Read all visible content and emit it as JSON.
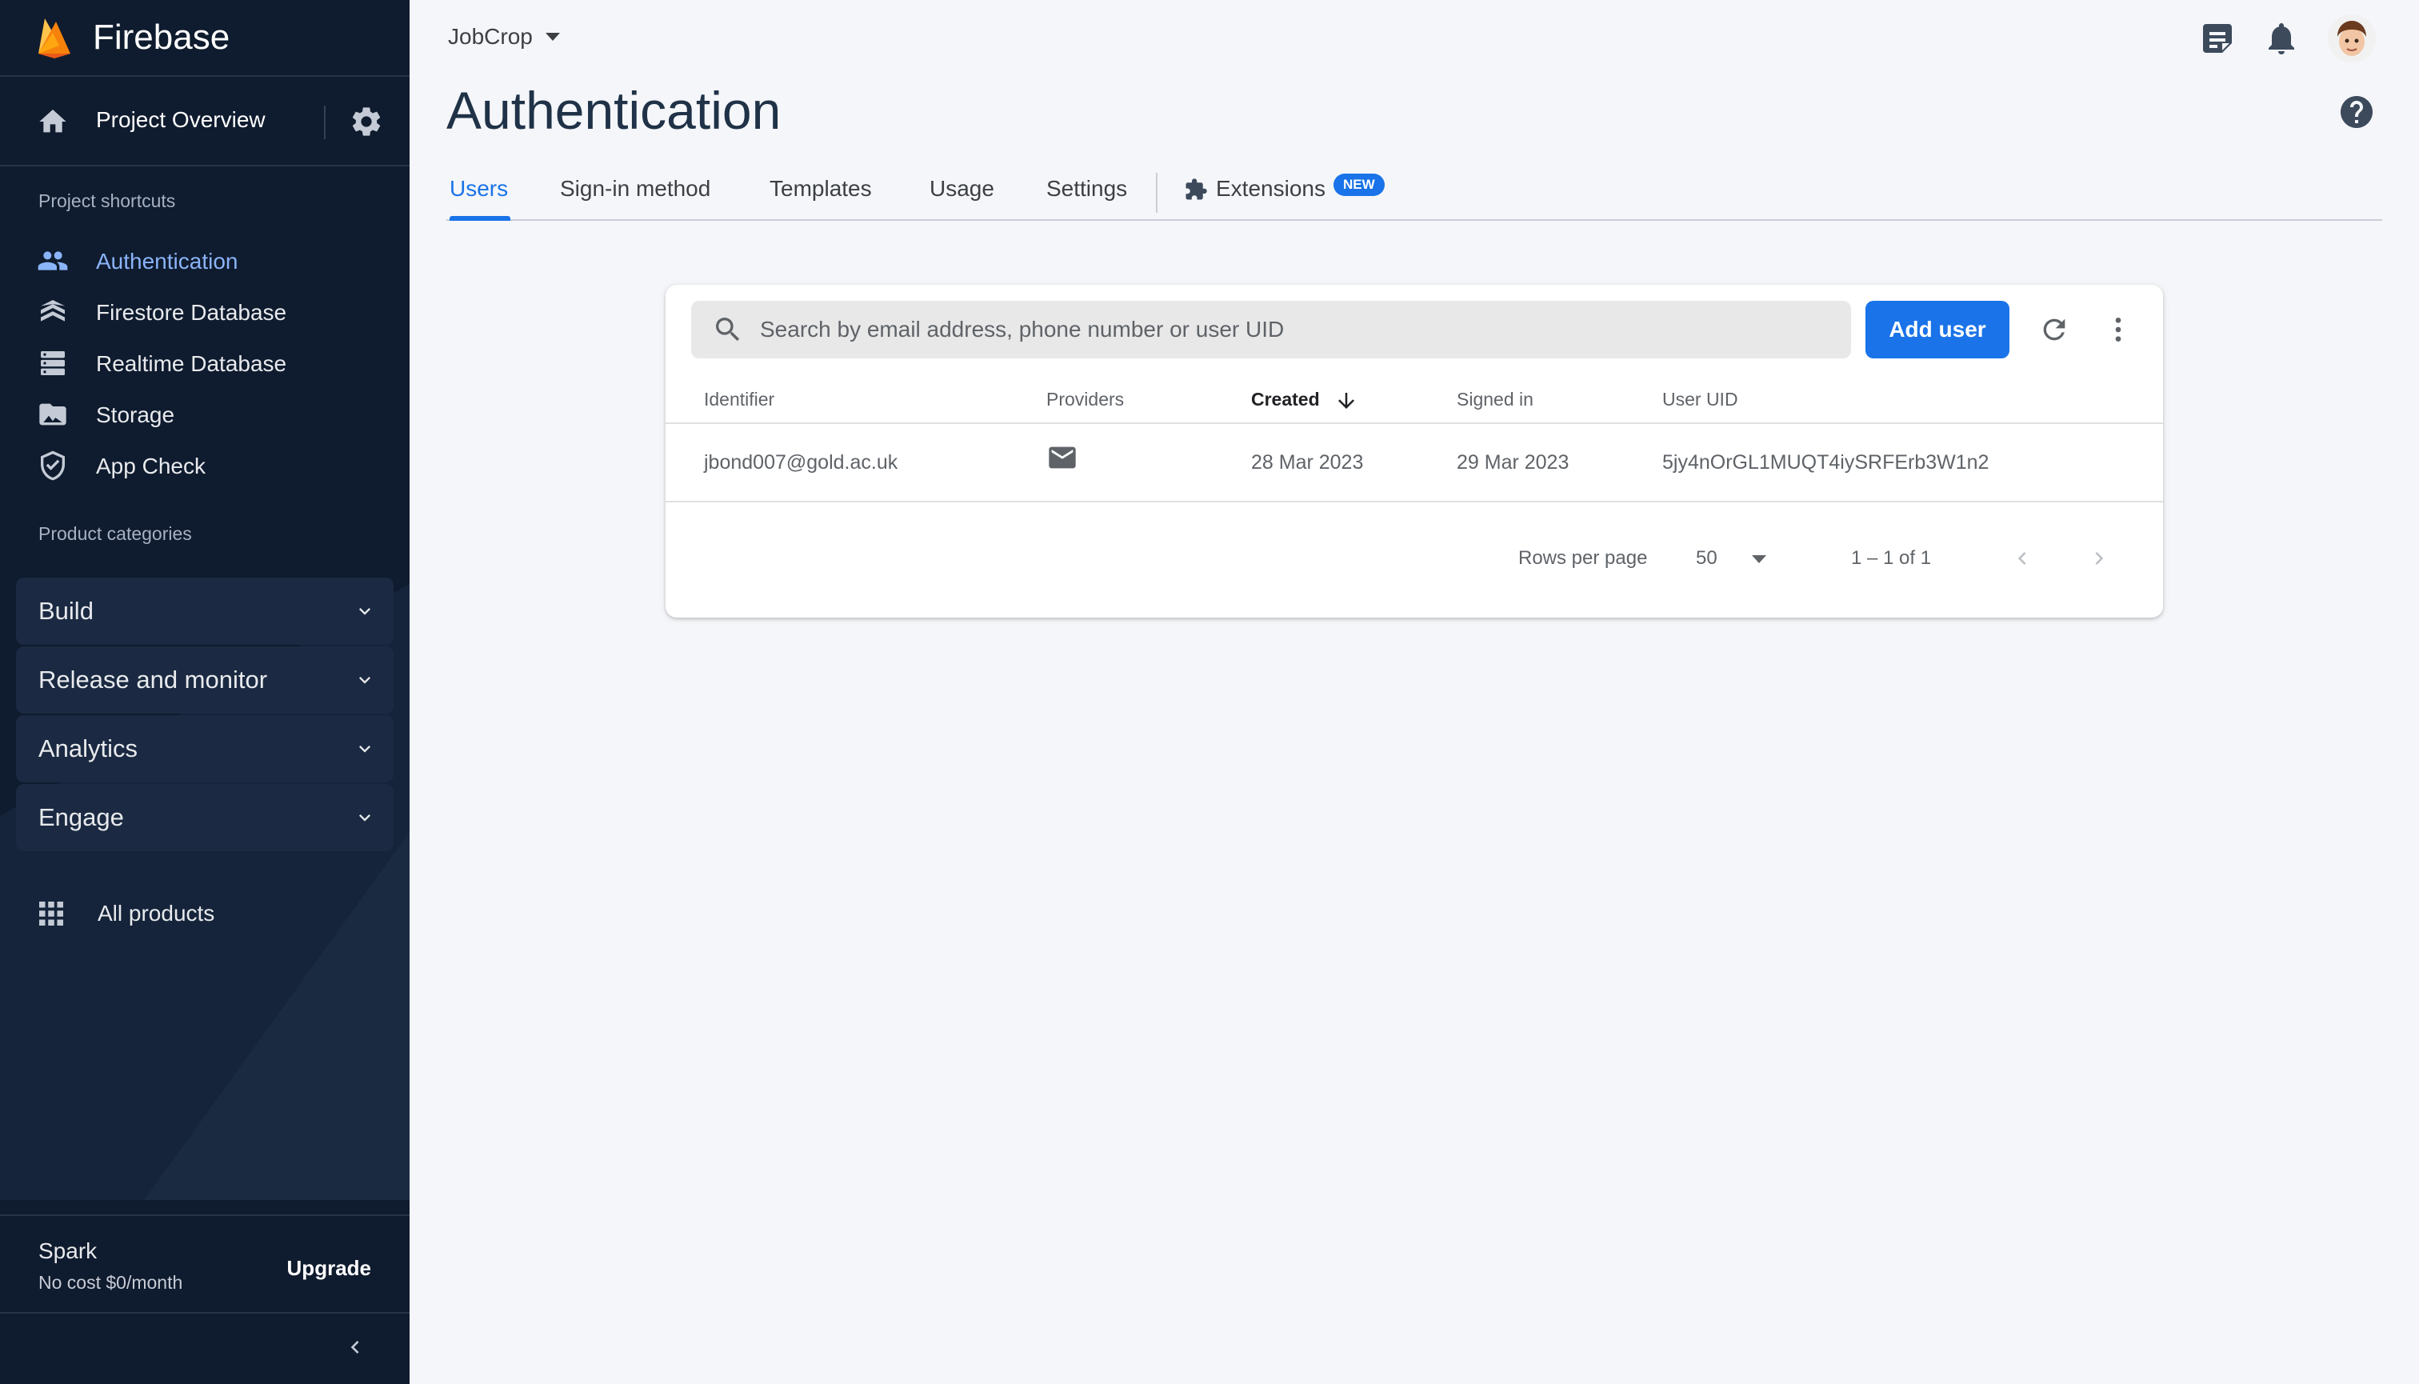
{
  "colors": {
    "sidebar_bg": "#0f1b2e",
    "accent": "#1a73e8",
    "active_nav": "#8ab4f8",
    "page_bg": "#f5f6f9",
    "firebase_orange": "#ffa611"
  },
  "sidebar": {
    "brand": "Firebase",
    "overview_label": "Project Overview",
    "shortcuts_heading": "Project shortcuts",
    "shortcuts": [
      {
        "label": "Authentication",
        "icon": "people-icon",
        "active": true
      },
      {
        "label": "Firestore Database",
        "icon": "firestore-icon"
      },
      {
        "label": "Realtime Database",
        "icon": "database-icon"
      },
      {
        "label": "Storage",
        "icon": "image-icon"
      },
      {
        "label": "App Check",
        "icon": "shield-check-icon"
      }
    ],
    "categories_heading": "Product categories",
    "categories": [
      {
        "label": "Build"
      },
      {
        "label": "Release and monitor"
      },
      {
        "label": "Analytics"
      },
      {
        "label": "Engage"
      }
    ],
    "all_products": "All products",
    "plan": {
      "name": "Spark",
      "description": "No cost $0/month",
      "upgrade_label": "Upgrade"
    }
  },
  "topbar": {
    "project_name": "JobCrop"
  },
  "page": {
    "title": "Authentication",
    "tabs": [
      {
        "label": "Users",
        "active": true
      },
      {
        "label": "Sign-in method"
      },
      {
        "label": "Templates"
      },
      {
        "label": "Usage"
      },
      {
        "label": "Settings"
      },
      {
        "label": "Extensions",
        "badge": "NEW"
      }
    ]
  },
  "users_table": {
    "search_placeholder": "Search by email address, phone number or user UID",
    "add_user_label": "Add user",
    "columns": [
      "Identifier",
      "Providers",
      "Created",
      "Signed in",
      "User UID"
    ],
    "sorted_column": "Created",
    "rows": [
      {
        "identifier": "jbond007@gold.ac.uk",
        "provider_icon": "email-icon",
        "created": "28 Mar 2023",
        "signed_in": "29 Mar 2023",
        "uid": "5jy4nOrGL1MUQT4iySRFErb3W1n2"
      }
    ],
    "pagination": {
      "rows_per_page_label": "Rows per page",
      "rows_per_page_value": "50",
      "range": "1 – 1 of 1"
    }
  }
}
